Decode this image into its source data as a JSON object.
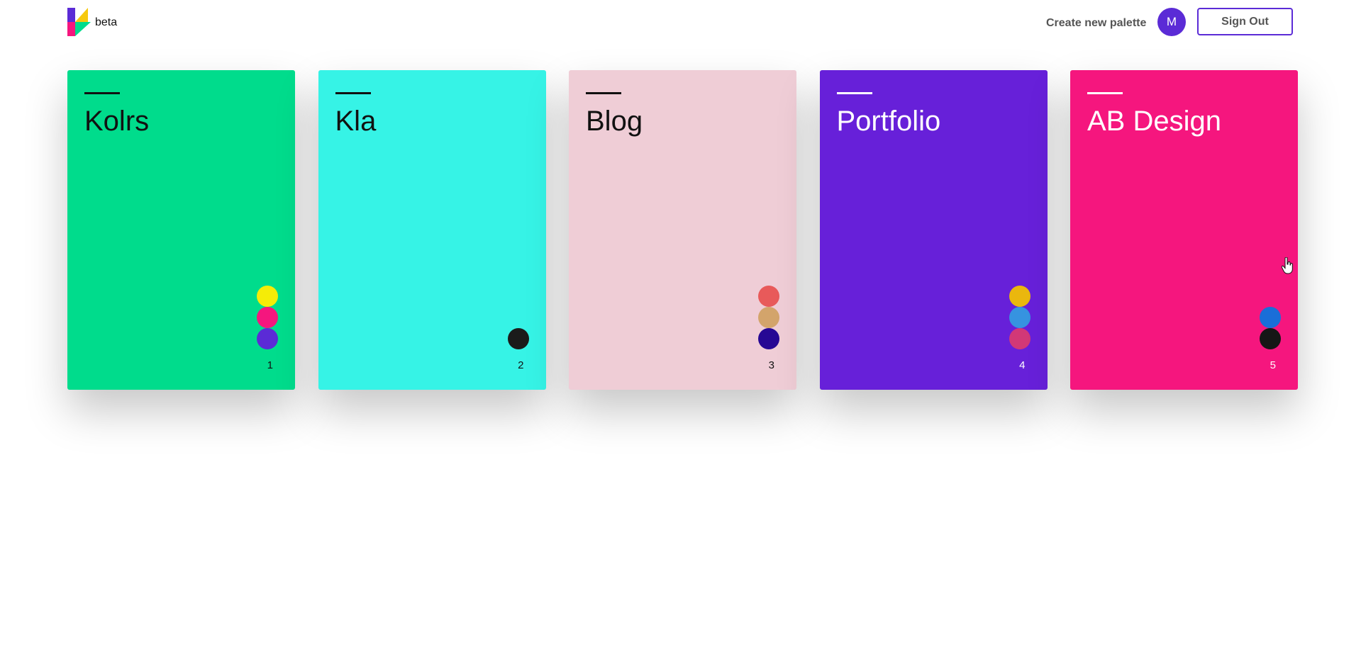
{
  "header": {
    "logo_text": "beta",
    "create_link": "Create new palette",
    "avatar_initial": "M",
    "signout_label": "Sign Out"
  },
  "palettes": [
    {
      "title": "Kolrs",
      "number": "1",
      "background": "#00dc8c",
      "text_color": "#111111",
      "swatches": [
        "#f5ec07",
        "#f5167e",
        "#5b2bd6"
      ]
    },
    {
      "title": "Kla",
      "number": "2",
      "background": "#36f3e6",
      "text_color": "#111111",
      "swatches": [
        "#1b1b1b"
      ]
    },
    {
      "title": "Blog",
      "number": "3",
      "background": "#efcdd6",
      "text_color": "#111111",
      "swatches": [
        "#e85a5a",
        "#d3a46b",
        "#260894"
      ]
    },
    {
      "title": "Portfolio",
      "number": "4",
      "background": "#6720d9",
      "text_color": "#ffffff",
      "swatches": [
        "#eab70e",
        "#3693e0",
        "#d23877"
      ]
    },
    {
      "title": "AB Design",
      "number": "5",
      "background": "#f5167e",
      "text_color": "#ffffff",
      "swatches": [
        "#1a6ed8",
        "#161616"
      ]
    }
  ]
}
